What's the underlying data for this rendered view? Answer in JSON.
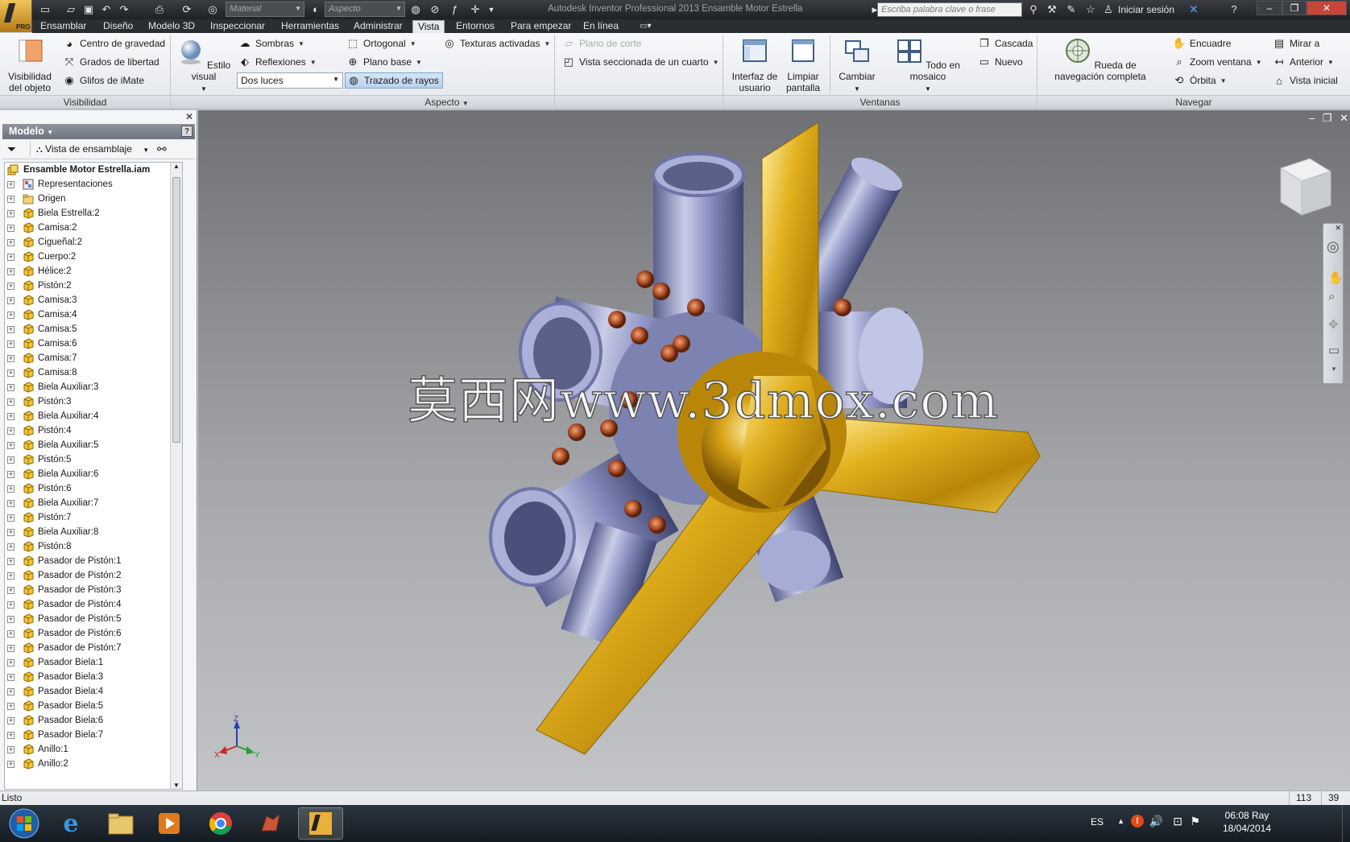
{
  "window": {
    "app_title": "Autodesk Inventor Professional 2013    Ensamble Motor Estrella",
    "pro_badge": "PRO",
    "material_placeholder": "Material",
    "appearance_placeholder": "Aspecto",
    "search_placeholder": "Escriba palabra clave o frase",
    "signin_label": "Iniciar sesión"
  },
  "menu_tabs": [
    {
      "label": "Ensamblar"
    },
    {
      "label": "Diseño"
    },
    {
      "label": "Modelo 3D"
    },
    {
      "label": "Inspeccionar"
    },
    {
      "label": "Herramientas"
    },
    {
      "label": "Administrar"
    },
    {
      "label": "Vista",
      "active": true
    },
    {
      "label": "Entornos"
    },
    {
      "label": "Para empezar"
    },
    {
      "label": "En línea"
    }
  ],
  "ribbon": {
    "visibility": {
      "title": "Visibilidad",
      "object_visibility": "Visibilidad del objeto",
      "center_gravity": "Centro de gravedad",
      "degrees_freedom": "Grados de libertad",
      "imate_glyphs": "Glifos de iMate"
    },
    "appearance": {
      "title": "Aspecto",
      "visual_style": "Estilo visual",
      "shadows": "Sombras",
      "reflections": "Reflexiones",
      "lighting_value": "Dos luces",
      "orthographic": "Ortogonal",
      "ground_plane": "Plano base",
      "ray_tracing": "Trazado de rayos",
      "textures_on": "Texturas activadas",
      "section_plane": "Plano de corte",
      "quarter_section": "Vista seccionada de un cuarto"
    },
    "windows": {
      "title": "Ventanas",
      "user_interface": "Interfaz de usuario",
      "clean_screen": "Limpiar pantalla",
      "switch": "Cambiar",
      "tile_all": "Todo en mosaico",
      "cascade": "Cascada",
      "new": "Nuevo"
    },
    "navigate": {
      "title": "Navegar",
      "full_wheel": "Rueda de navegación completa",
      "pan": "Encuadre",
      "zoom_window": "Zoom ventana",
      "orbit": "Órbita",
      "look_at": "Mirar a",
      "previous": "Anterior",
      "home_view": "Vista inicial"
    }
  },
  "browser": {
    "title": "Modelo",
    "view_mode": "Vista de ensamblaje",
    "root": "Ensamble Motor Estrella.iam",
    "items": [
      "Representaciones",
      "Origen",
      "Biela Estrella:2",
      "Camisa:2",
      "Cigueñal:2",
      "Cuerpo:2",
      "Hélice:2",
      "Pistón:2",
      "Camisa:3",
      "Camisa:4",
      "Camisa:5",
      "Camisa:6",
      "Camisa:7",
      "Camisa:8",
      "Biela Auxiliar:3",
      "Pistón:3",
      "Biela Auxiliar:4",
      "Pistón:4",
      "Biela Auxiliar:5",
      "Pistón:5",
      "Biela Auxiliar:6",
      "Pistón:6",
      "Biela Auxiliar:7",
      "Pistón:7",
      "Biela Auxiliar:8",
      "Pistón:8",
      "Pasador de Pistón:1",
      "Pasador de Pistón:2",
      "Pasador de Pistón:3",
      "Pasador de Pistón:4",
      "Pasador de Pistón:5",
      "Pasador de Pistón:6",
      "Pasador de Pistón:7",
      "Pasador Biela:1",
      "Pasador Biela:3",
      "Pasador Biela:4",
      "Pasador Biela:5",
      "Pasador Biela:6",
      "Pasador Biela:7",
      "Anillo:1",
      "Anillo:2"
    ]
  },
  "viewport": {
    "watermark": "莫西网www.3dmox.com",
    "axis_x": "X",
    "axis_y": "Y",
    "axis_z": "Z"
  },
  "status": {
    "text": "Listo",
    "num1": "113",
    "num2": "39"
  },
  "taskbar": {
    "lang": "ES",
    "time": "06:08 Ray",
    "date": "18/04/2014"
  },
  "colors": {
    "propeller_gold": "#e3b21f",
    "cylinder_steel": "#8f95c4",
    "bolt_copper": "#b5532a"
  }
}
